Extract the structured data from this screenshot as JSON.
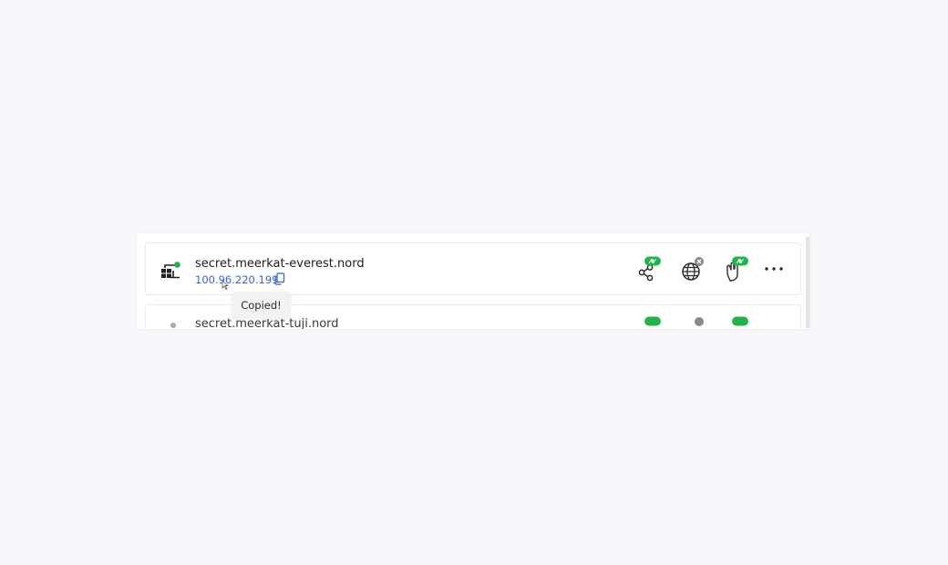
{
  "devices": [
    {
      "hostname": "secret.meerkat-everest.nord",
      "ip": "100.96.220.199",
      "status": "online",
      "status_color": "#23b14d"
    },
    {
      "hostname": "secret.meerkat-tuji.nord",
      "status_color": "#23b14d"
    }
  ],
  "tooltip": {
    "text": "Copied!"
  },
  "icons": {
    "device": "device-grid-icon",
    "copy": "copy-icon",
    "share": "share-icon",
    "globe": "globe-icon",
    "hand": "hand-icon",
    "more": "more-horizontal-icon"
  },
  "colors": {
    "link": "#3a63d8",
    "badge_green": "#23b14d",
    "badge_gray": "#8a8a8a"
  }
}
